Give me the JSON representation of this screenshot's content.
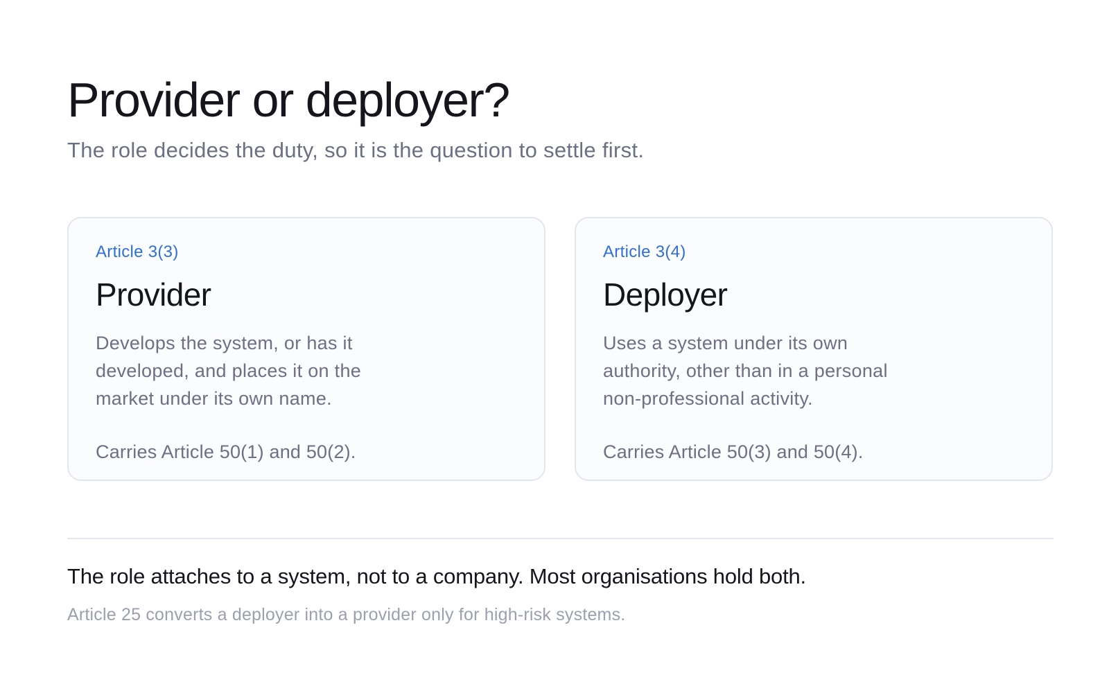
{
  "header": {
    "title": "Provider or deployer?",
    "subtitle": "The role decides the duty, so it is the question to settle first."
  },
  "cards": [
    {
      "article": "Article 3(3)",
      "role": "Provider",
      "description": "Develops the system, or has it developed, and places it on the market under its own name.",
      "carries": "Carries Article 50(1) and 50(2)."
    },
    {
      "article": "Article 3(4)",
      "role": "Deployer",
      "description": "Uses a system under its own authority, other than in a personal non-professional activity.",
      "carries": "Carries Article 50(3) and 50(4)."
    }
  ],
  "footer": {
    "statement": "The role attaches to a system, not to a company. Most organisations hold both.",
    "note": "Article 25 converts a deployer into a provider only for high-risk systems."
  },
  "colors": {
    "accent": "#2f6fdc",
    "heading": "#14161c",
    "muted": "#6a7184",
    "faint": "#9aa0ae",
    "border": "#e3e6ec"
  }
}
